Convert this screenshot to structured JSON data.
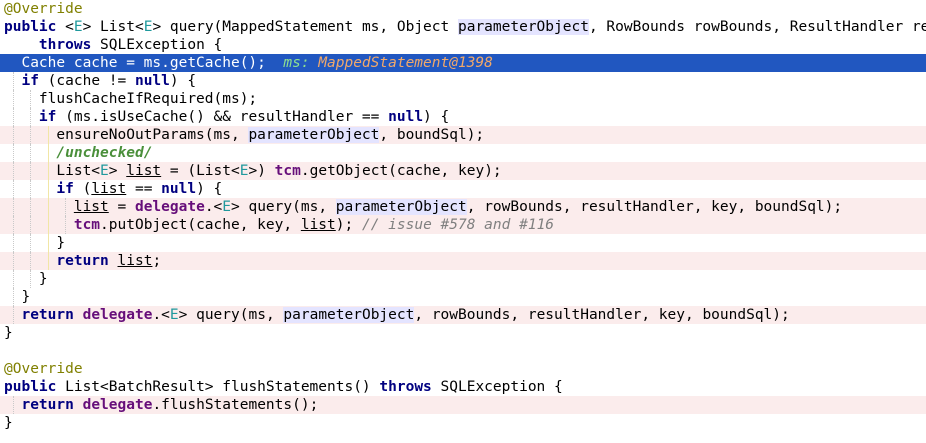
{
  "editor": {
    "lines": [
      {
        "style": "",
        "indent": 0,
        "guides": [],
        "tokens": [
          [
            "ann",
            "@Override"
          ]
        ]
      },
      {
        "style": "",
        "indent": 0,
        "guides": [],
        "tokens": [
          [
            "kw",
            "public"
          ],
          [
            "plain",
            " <"
          ],
          [
            "type",
            "E"
          ],
          [
            "plain",
            "> List<"
          ],
          [
            "type",
            "E"
          ],
          [
            "plain",
            "> query(MappedStatement ms, Object "
          ],
          [
            "param",
            "parameterObject"
          ],
          [
            "plain",
            ", RowBounds rowBounds, ResultHandler resultHandler)"
          ]
        ]
      },
      {
        "style": "",
        "indent": 0,
        "guides": [],
        "tokens": [
          [
            "plain",
            "    "
          ],
          [
            "kw",
            "throws"
          ],
          [
            "plain",
            " SQLException {"
          ]
        ]
      },
      {
        "style": "selected",
        "indent": 0,
        "guides": [],
        "tokens": [
          [
            "plain",
            "  Cache cache = ms.getCache();  "
          ],
          [
            "debug",
            "ms: "
          ],
          [
            "debugval",
            "MappedStatement@1398"
          ]
        ]
      },
      {
        "style": "",
        "indent": 0,
        "guides": [
          1
        ],
        "tokens": [
          [
            "plain",
            "  "
          ],
          [
            "kw",
            "if"
          ],
          [
            "plain",
            " (cache != "
          ],
          [
            "kw",
            "null"
          ],
          [
            "plain",
            ") {"
          ]
        ]
      },
      {
        "style": "",
        "indent": 0,
        "guides": [
          1,
          2
        ],
        "tokens": [
          [
            "plain",
            "    flushCacheIfRequired(ms);"
          ]
        ]
      },
      {
        "style": "",
        "indent": 0,
        "guides": [
          1,
          2
        ],
        "tokens": [
          [
            "plain",
            "    "
          ],
          [
            "kw",
            "if"
          ],
          [
            "plain",
            " (ms.isUseCache() && resultHandler == "
          ],
          [
            "kw",
            "null"
          ],
          [
            "plain",
            ") {"
          ]
        ]
      },
      {
        "style": "pink",
        "indent": 0,
        "guides": [
          1,
          2,
          3
        ],
        "tokens": [
          [
            "plain",
            "      ensureNoOutParams(ms, "
          ],
          [
            "param",
            "parameterObject"
          ],
          [
            "plain",
            ", boundSql);"
          ]
        ]
      },
      {
        "style": "",
        "indent": 0,
        "guides": [
          1,
          2,
          3
        ],
        "tokens": [
          [
            "plain",
            "      "
          ],
          [
            "str",
            "/unchecked/"
          ]
        ]
      },
      {
        "style": "pink",
        "indent": 0,
        "guides": [
          1,
          2,
          3
        ],
        "tokens": [
          [
            "plain",
            "      List<"
          ],
          [
            "type",
            "E"
          ],
          [
            "plain",
            "> "
          ],
          [
            "var",
            "list"
          ],
          [
            "plain",
            " = (List<"
          ],
          [
            "type",
            "E"
          ],
          [
            "plain",
            ">) "
          ],
          [
            "field",
            "tcm"
          ],
          [
            "plain",
            ".getObject(cache, key);"
          ]
        ]
      },
      {
        "style": "",
        "indent": 0,
        "guides": [
          1,
          2,
          3
        ],
        "tokens": [
          [
            "plain",
            "      "
          ],
          [
            "kw",
            "if"
          ],
          [
            "plain",
            " ("
          ],
          [
            "var",
            "list"
          ],
          [
            "plain",
            " == "
          ],
          [
            "kw",
            "null"
          ],
          [
            "plain",
            ") {"
          ]
        ]
      },
      {
        "style": "pink",
        "indent": 0,
        "guides": [
          1,
          2,
          3,
          4
        ],
        "tokens": [
          [
            "plain",
            "        "
          ],
          [
            "var",
            "list"
          ],
          [
            "plain",
            " = "
          ],
          [
            "field",
            "delegate"
          ],
          [
            "plain",
            ".<"
          ],
          [
            "type",
            "E"
          ],
          [
            "plain",
            "> query(ms, "
          ],
          [
            "param",
            "parameterObject"
          ],
          [
            "plain",
            ", rowBounds, resultHandler, key, boundSql);"
          ]
        ]
      },
      {
        "style": "pink",
        "indent": 0,
        "guides": [
          1,
          2,
          3,
          4
        ],
        "tokens": [
          [
            "plain",
            "        "
          ],
          [
            "field",
            "tcm"
          ],
          [
            "plain",
            ".putObject(cache, key, "
          ],
          [
            "var",
            "list"
          ],
          [
            "plain",
            "); "
          ],
          [
            "cmt",
            "// issue #578 and #116"
          ]
        ]
      },
      {
        "style": "",
        "indent": 0,
        "guides": [
          1,
          2,
          3
        ],
        "tokens": [
          [
            "plain",
            "      }"
          ]
        ]
      },
      {
        "style": "pink",
        "indent": 0,
        "guides": [
          1,
          2,
          3
        ],
        "tokens": [
          [
            "plain",
            "      "
          ],
          [
            "kw",
            "return"
          ],
          [
            "plain",
            " "
          ],
          [
            "var",
            "list"
          ],
          [
            "plain",
            ";"
          ]
        ]
      },
      {
        "style": "",
        "indent": 0,
        "guides": [
          1,
          2
        ],
        "tokens": [
          [
            "plain",
            "    }"
          ]
        ]
      },
      {
        "style": "",
        "indent": 0,
        "guides": [
          1
        ],
        "tokens": [
          [
            "plain",
            "  }"
          ]
        ]
      },
      {
        "style": "pink",
        "indent": 0,
        "guides": [
          1
        ],
        "tokens": [
          [
            "plain",
            "  "
          ],
          [
            "kw",
            "return"
          ],
          [
            "plain",
            " "
          ],
          [
            "field",
            "delegate"
          ],
          [
            "plain",
            ".<"
          ],
          [
            "type",
            "E"
          ],
          [
            "plain",
            "> query(ms, "
          ],
          [
            "param",
            "parameterObject"
          ],
          [
            "plain",
            ", rowBounds, resultHandler, key, boundSql);"
          ]
        ]
      },
      {
        "style": "",
        "indent": 0,
        "guides": [],
        "tokens": [
          [
            "plain",
            "}"
          ]
        ]
      },
      {
        "style": "",
        "indent": 0,
        "guides": [],
        "tokens": [
          [
            "plain",
            ""
          ]
        ]
      },
      {
        "style": "",
        "indent": 0,
        "guides": [],
        "tokens": [
          [
            "ann",
            "@Override"
          ]
        ]
      },
      {
        "style": "",
        "indent": 0,
        "guides": [],
        "tokens": [
          [
            "kw",
            "public"
          ],
          [
            "plain",
            " List<BatchResult> flushStatements() "
          ],
          [
            "kw",
            "throws"
          ],
          [
            "plain",
            " SQLException {"
          ]
        ]
      },
      {
        "style": "pink",
        "indent": 0,
        "guides": [
          1
        ],
        "tokens": [
          [
            "plain",
            "  "
          ],
          [
            "kw",
            "return"
          ],
          [
            "plain",
            " "
          ],
          [
            "field",
            "delegate"
          ],
          [
            "plain",
            ".flushStatements();"
          ]
        ]
      },
      {
        "style": "",
        "indent": 0,
        "guides": [],
        "tokens": [
          [
            "plain",
            "}"
          ]
        ]
      }
    ]
  }
}
